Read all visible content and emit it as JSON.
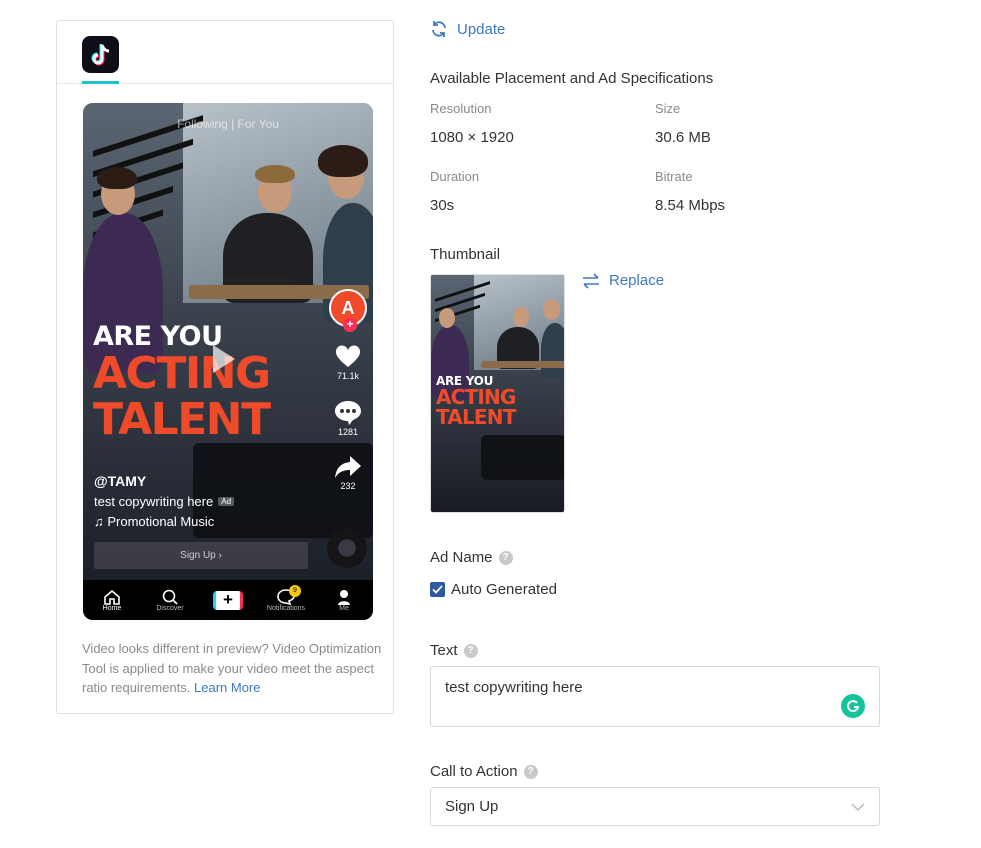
{
  "preview": {
    "platform_icon": "tiktok-logo",
    "video": {
      "feed_tabs": "Following | For You",
      "headline_line1": "ARE YOU",
      "headline_line2": "ACTING",
      "headline_line3": "TALENT",
      "handle": "@TAMY",
      "copy": "test copywriting here",
      "ad_tag": "Ad",
      "music": "♫ Promotional Music",
      "cta": "Sign Up ›",
      "likes": "71.1k",
      "comments": "1281",
      "shares": "232"
    },
    "nav": {
      "home": "Home",
      "discover": "Discover",
      "plus": "+",
      "notifications": "Notifications",
      "notif_badge": "9",
      "me": "Me"
    },
    "note_text": "Video looks different in preview? Video Optimization Tool is applied to make your video meet the aspect ratio requirements.",
    "note_link": "Learn More"
  },
  "details": {
    "update_label": "Update",
    "specs_title": "Available Placement and Ad Specifications",
    "resolution_label": "Resolution",
    "resolution_value": "1080 × 1920",
    "size_label": "Size",
    "size_value": "30.6 MB",
    "duration_label": "Duration",
    "duration_value": "30s",
    "bitrate_label": "Bitrate",
    "bitrate_value": "8.54 Mbps",
    "thumbnail_label": "Thumbnail",
    "replace_label": "Replace",
    "ad_name_label": "Ad Name",
    "auto_generated_label": "Auto Generated",
    "auto_generated_checked": true,
    "text_label": "Text",
    "text_value": "test copywriting here",
    "cta_label": "Call to Action",
    "cta_value": "Sign Up"
  },
  "colors": {
    "link": "#3b79c3",
    "accent_teal": "#22c2c9",
    "headline_red": "#ef4b2a",
    "checkbox": "#2f5aa0",
    "grammarly": "#15c39a"
  }
}
